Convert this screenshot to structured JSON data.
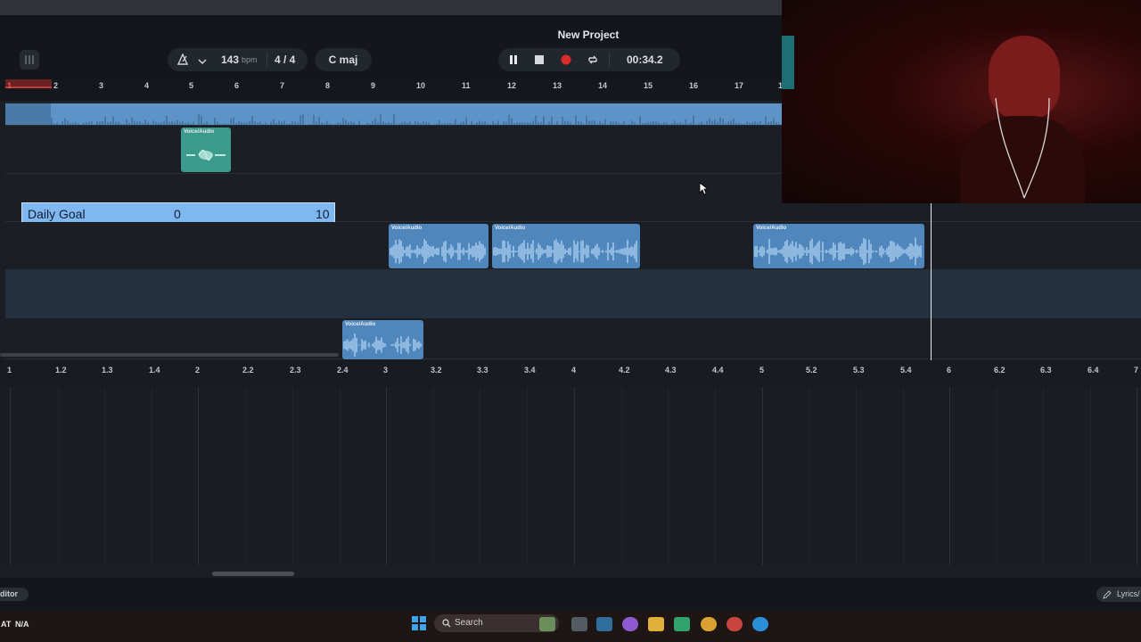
{
  "header": {
    "project_title": "New Project"
  },
  "toolbar": {
    "tempo_value": "143",
    "tempo_unit": "bpm",
    "time_signature": "4 / 4",
    "key": "C maj",
    "time_display": "00:34.2"
  },
  "ruler_bars": [
    "1",
    "2",
    "3",
    "4",
    "5",
    "6",
    "7",
    "8",
    "9",
    "10",
    "11",
    "12",
    "13",
    "14",
    "15",
    "16",
    "17",
    "1"
  ],
  "clips": {
    "label": "Voice/Audio"
  },
  "daily_goal": {
    "label": "Daily Goal",
    "current": "0",
    "target": "10"
  },
  "lower_ruler": [
    "1",
    "1.2",
    "1.3",
    "1.4",
    "2",
    "2.2",
    "2.3",
    "2.4",
    "3",
    "3.2",
    "3.3",
    "3.4",
    "4",
    "4.2",
    "4.3",
    "4.4",
    "5",
    "5.2",
    "5.3",
    "5.4",
    "6",
    "6.2",
    "6.3",
    "6.4",
    "7"
  ],
  "bottom": {
    "editor_label": "ditor",
    "lyrics_label": "Lyrics/"
  },
  "taskbar": {
    "left_status_1": "AT",
    "left_status_2": "N/A",
    "search_label": "Search"
  },
  "colors": {
    "accent_blue": "#5d93c7",
    "clip_teal": "#3b9a8c",
    "record_red": "#d92b2b"
  }
}
